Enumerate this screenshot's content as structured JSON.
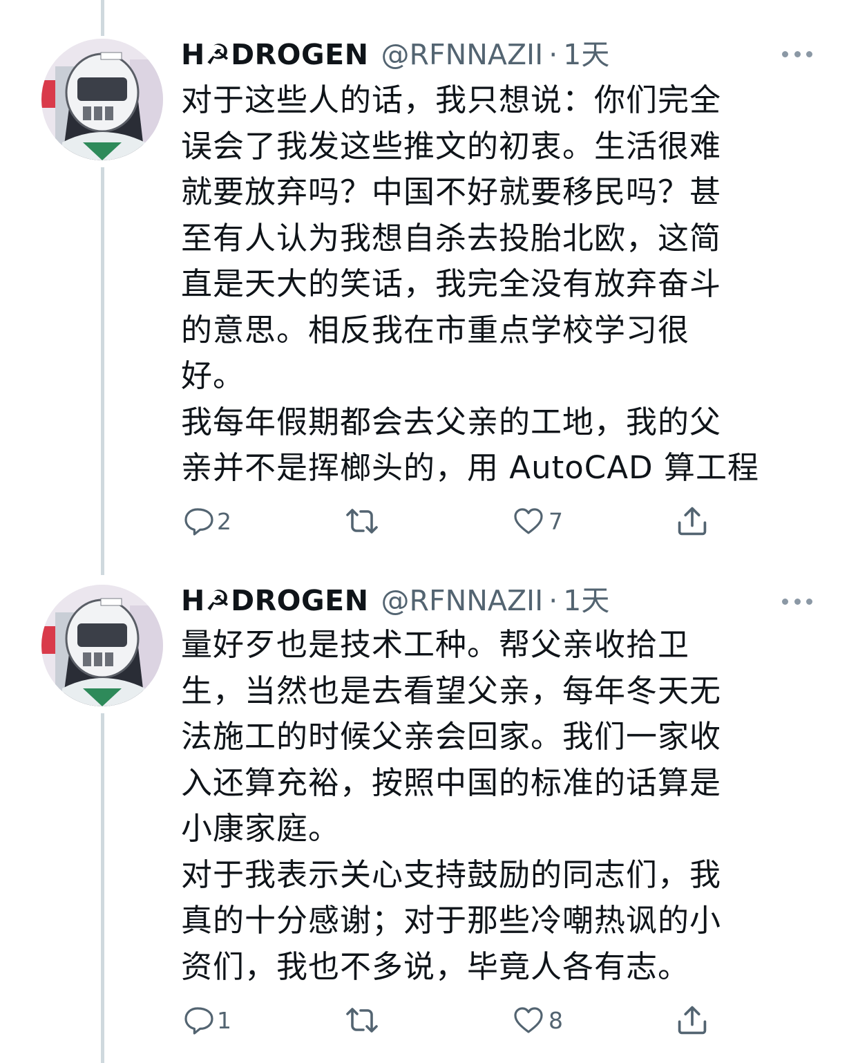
{
  "tweets": [
    {
      "display_name": "H☭DROGEN",
      "handle": "@RFNNAZII",
      "separator": "·",
      "time": "1天",
      "lines": [
        "对于这些人的话，我只想说：你们完全",
        "误会了我发这些推文的初衷。生活很难",
        "就要放弃吗？中国不好就要移民吗？甚",
        "至有人认为我想自杀去投胎北欧，这简",
        "直是天大的笑话，我完全没有放弃奋斗",
        "的意思。相反我在市重点学校学习很",
        "好。",
        "我每年假期都会去父亲的工地，我的父",
        "亲并不是挥榔头的，用 AutoCAD 算工程"
      ],
      "reply_count": "2",
      "retweet_count": "",
      "like_count": "7",
      "icons": {
        "reply": "reply-icon",
        "retweet": "retweet-icon",
        "like": "heart-icon",
        "share": "share-icon",
        "more": "more-dots-icon"
      }
    },
    {
      "display_name": "H☭DROGEN",
      "handle": "@RFNNAZII",
      "separator": "·",
      "time": "1天",
      "lines": [
        "量好歹也是技术工种。帮父亲收拾卫",
        "生，当然也是去看望父亲，每年冬天无",
        "法施工的时候父亲会回家。我们一家收",
        "入还算充裕，按照中国的标准的话算是",
        "小康家庭。",
        "对于我表示关心支持鼓励的同志们，我",
        "真的十分感谢；对于那些冷嘲热讽的小",
        "资们，我也不多说，毕竟人各有志。"
      ],
      "reply_count": "1",
      "retweet_count": "",
      "like_count": "8",
      "icons": {
        "reply": "reply-icon",
        "retweet": "retweet-icon",
        "like": "heart-icon",
        "share": "share-icon",
        "more": "more-dots-icon"
      }
    }
  ],
  "colors": {
    "text_primary": "#0f1419",
    "text_secondary": "#536471",
    "thread_line": "#cfd9de"
  }
}
